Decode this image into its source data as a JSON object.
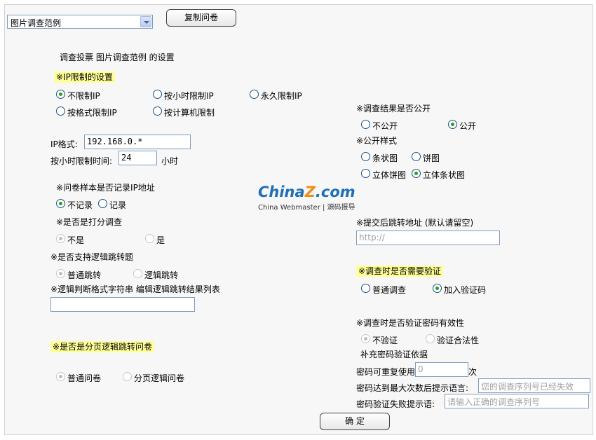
{
  "survey_select": {
    "selected": "图片调查范例"
  },
  "copy_button": "复制问卷",
  "settings_title": "调查投票 图片调查范例 的设置",
  "ip_section": {
    "title": "※IP限制的设置",
    "options": [
      "不限制IP",
      "按小时限制IP",
      "永久限制IP",
      "按格式限制IP",
      "按计算机限制"
    ],
    "selected": "不限制IP",
    "ip_format_label": "IP格式:",
    "ip_format_value": "192.168.0.*",
    "hours_label": "按小时限制时间:",
    "hours_value": "24",
    "hours_unit": "小时"
  },
  "record_ip": {
    "title": "※问卷样本是否记录IP地址",
    "options": [
      "不记录",
      "记录"
    ],
    "selected": "不记录"
  },
  "scoring": {
    "title": "※是否是打分调查",
    "options": [
      "不是",
      "是"
    ],
    "selected": "不是"
  },
  "logic_jump": {
    "title": "※是否支持逻辑跳转题",
    "options": [
      "普通跳转",
      "逻辑跳转"
    ],
    "selected": "普通跳转"
  },
  "logic_format": {
    "label": "※逻辑判断格式字符串 编辑逻辑跳转结果列表",
    "value": ""
  },
  "paged_jump": {
    "title": "※是否是分页逻辑跳转问卷",
    "options": [
      "普通问卷",
      "分页逻辑问卷"
    ],
    "selected": "普通问卷"
  },
  "public_result": {
    "title": "※调查结果是否公开",
    "options": [
      "不公开",
      "公开"
    ],
    "selected": "公开"
  },
  "public_style": {
    "title": "※公开样式",
    "options": [
      "条状图",
      "饼图",
      "立体饼图",
      "立体条状图"
    ],
    "selected": "立体条状图"
  },
  "watermark": {
    "brand_a": "China",
    "brand_b": "Z",
    "brand_c": ".com",
    "tagline": "China Webmaster | 源码报导"
  },
  "redirect": {
    "label": "※提交后跳转地址 (默认请留空)",
    "placeholder": "http://"
  },
  "verify": {
    "title": "※调查时是否需要验证",
    "options": [
      "普通调查",
      "加入验证码"
    ],
    "selected": "加入验证码"
  },
  "password_check": {
    "title": "※调查时是否验证密码有效性",
    "options": [
      "不验证",
      "验证合法性"
    ],
    "selected": "不验证",
    "note": "补充密码验证依据",
    "reuse_label": "密码可重复使用",
    "reuse_value": "0",
    "reuse_unit": "次",
    "max_label": "密码达到最大次数后提示语言:",
    "max_placeholder": "您的调查序列号已经失效",
    "fail_label": "密码验证失败提示语:",
    "fail_placeholder": "请输入正确的调查序列号"
  },
  "confirm_button": "确 定"
}
